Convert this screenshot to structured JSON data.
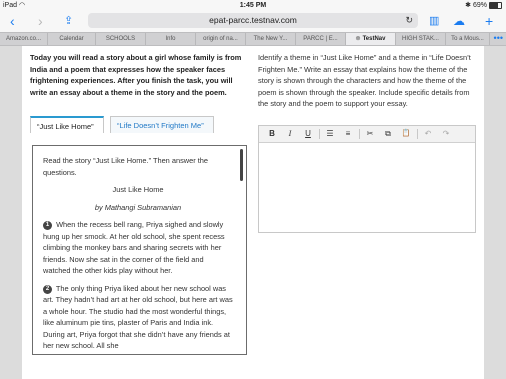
{
  "status": {
    "device": "iPad",
    "time": "1:45 PM",
    "battery": "69%"
  },
  "browser": {
    "url": "epat-parcc.testnav.com",
    "tabs": [
      {
        "label": "Amazon.co..."
      },
      {
        "label": "Calendar"
      },
      {
        "label": "SCHOOLS"
      },
      {
        "label": "Info"
      },
      {
        "label": "origin of na..."
      },
      {
        "label": "The New Y..."
      },
      {
        "label": "PARCC | E..."
      },
      {
        "label": "TestNav"
      },
      {
        "label": "HIGH STAK..."
      },
      {
        "label": "To a Mous..."
      }
    ],
    "more": "•••"
  },
  "task": {
    "instructions": "Today you will read a story about a girl whose family is from India and a poem that expresses how the speaker faces frightening experiences. After you finish the task, you will write an essay about a theme in the story and the poem.",
    "prompt": "Identify a theme in “Just Like Home” and a theme in “Life Doesn’t Frighten Me.” Write an essay that explains how the theme of the story is shown through the characters and how the theme of the poem is shown through the speaker. Include specific details from the story and the poem to support your essay."
  },
  "passage_tabs": [
    {
      "label": "“Just Like Home”"
    },
    {
      "label": "“Life Doesn’t Frighten Me”"
    }
  ],
  "passage": {
    "intro": "Read the story “Just Like Home.” Then answer the questions.",
    "title": "Just Like Home",
    "byline": "by Mathangi Subramanian",
    "paragraphs": [
      {
        "num": "1",
        "text": "When the recess bell rang, Priya sighed and slowly hung up her smock. At her old school, she spent recess climbing the monkey bars and sharing secrets with her friends. Now she sat in the corner of the field and watched the other kids play without her."
      },
      {
        "num": "2",
        "text": "The only thing Priya liked about her new school was art. They hadn’t had art at her old school, but here art was a whole hour. The studio had the most wonderful things, like aluminum pie tins, plaster of Paris and India ink. During art, Priya forgot that she didn’t have any friends at her new school. All she"
      }
    ]
  },
  "editor": {
    "bold": "B",
    "italic": "I",
    "underline": "U",
    "bullets": "☰",
    "numbers": "≡",
    "cut": "✂",
    "copy": "⧉",
    "paste": "📋",
    "undo": "↶",
    "redo": "↷"
  }
}
